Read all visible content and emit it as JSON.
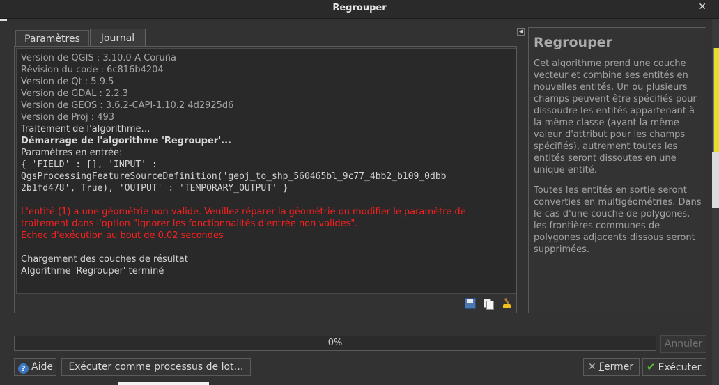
{
  "window": {
    "title": "Regrouper",
    "close_icon": "close-icon"
  },
  "tabs": [
    {
      "label": "Paramètres",
      "active": false
    },
    {
      "label": "Journal",
      "active": true
    }
  ],
  "log": {
    "info_lines": [
      "Version de QGIS : 3.10.0-A Coruña",
      "Révision du code : 6c816b4204",
      "Version de Qt : 5.9.5",
      "Version de GDAL : 2.2.3",
      "Version de GEOS : 3.6.2-CAPI-1.10.2 4d2925d6",
      "Version de Proj : 493"
    ],
    "processing": "Traitement de l'algorithme…",
    "start": "Démarrage de l'algorithme 'Regrouper'...",
    "params_label": "Paramètres en entrée:",
    "params_lines": [
      "{ 'FIELD' : [], 'INPUT' :",
      "QgsProcessingFeatureSourceDefinition('geoj_to_shp_560465bl_9c77_4bb2_b109_0dbb",
      "2b1fd478', True), 'OUTPUT' : 'TEMPORARY_OUTPUT' }"
    ],
    "error_lines": [
      "L'entité (1) a une géométrie non valide. Veuillez réparer la géométrie ou modifier le paramètre de",
      "traitement dans l'option \"Ignorer les fonctionnalités d'entrée non valides\".",
      "Échec d'exécution au bout de 0.02 secondes"
    ],
    "result_lines": [
      "Chargement des couches de résultat",
      "Algorithme 'Regrouper' terminé"
    ],
    "error_color": "#ff1f1f"
  },
  "log_toolbar": {
    "icons": [
      "save-icon",
      "copy-icon",
      "clear-icon"
    ]
  },
  "help": {
    "title": "Regrouper",
    "paragraphs": [
      "Cet algorithme prend une couche vecteur et combine ses entités en nouvelles entités. Un ou plusieurs champs peuvent être spécifiés pour dissoudre les entités appartenant à la même classe (ayant la même valeur d'attribut pour les champs spécifiés), autrement toutes les entités seront dissoutes en une unique entité.",
      "Toutes les entités en sortie seront converties en multigéométries. Dans le cas d'une couche de polygones, les frontières communes de polygones adjacents dissous seront supprimées."
    ]
  },
  "progress": {
    "value": 0,
    "text": "0%"
  },
  "buttons": {
    "annuler": "Annuler",
    "aide": "Aide",
    "lot": "Exécuter comme processus de lot…",
    "fermer_prefix": "F",
    "fermer_rest": "ermer",
    "executer": "Exécuter"
  },
  "colors": {
    "accent": "#3b78c2",
    "ok": "#5bbf2f"
  }
}
